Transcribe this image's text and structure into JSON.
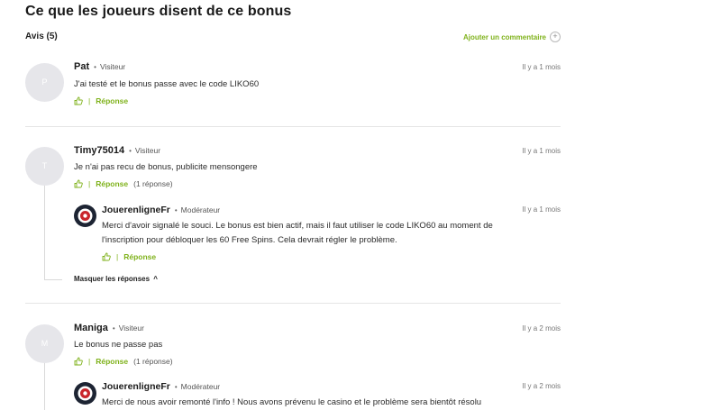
{
  "header": {
    "title": "Ce que les joueurs disent de ce bonus",
    "reviews_count": "Avis (5)",
    "add_comment": "Ajouter un commentaire"
  },
  "comments": [
    {
      "avatar_letter": "P",
      "author": "Pat",
      "role": "Visiteur",
      "time": "Il y a 1 mois",
      "text": "J'ai testé et le bonus passe avec le code LIKO60",
      "reply_label": "Réponse"
    },
    {
      "avatar_letter": "T",
      "author": "Timy75014",
      "role": "Visiteur",
      "time": "Il y a 1 mois",
      "text": "Je n'ai pas recu de bonus, publicite mensongere",
      "reply_label": "Réponse",
      "reply_count": "(1 réponse)",
      "hide_replies": "Masquer les réponses",
      "reply": {
        "author": "JouerenligneFr",
        "role": "Modérateur",
        "time": "Il y a 1 mois",
        "text_line1": "Merci d'avoir signalé le souci. Le bonus est bien actif, mais il faut utiliser le code LIKO60 au moment de",
        "text_line2": "l'inscription pour débloquer les 60 Free Spins. Cela devrait régler le problème.",
        "reply_label": "Réponse"
      }
    },
    {
      "avatar_letter": "M",
      "author": "Maniga",
      "role": "Visiteur",
      "time": "Il y a 2 mois",
      "text": "Le bonus ne passe pas",
      "reply_label": "Réponse",
      "reply_count": "(1 réponse)",
      "reply": {
        "author": "JouerenligneFr",
        "role": "Modérateur",
        "time": "Il y a 2 mois",
        "text_line1": "Merci de nous avoir remonté l'info ! Nous avons prévenu le casino et le problème sera bientôt résolu"
      }
    }
  ],
  "meta": {
    "separator": "•",
    "pipe": "|",
    "plus": "+",
    "caret": "^"
  },
  "colors": {
    "accent": "#7fb21b",
    "avatar_bg": "#e6e6ea",
    "divider": "#e5e5e5"
  }
}
